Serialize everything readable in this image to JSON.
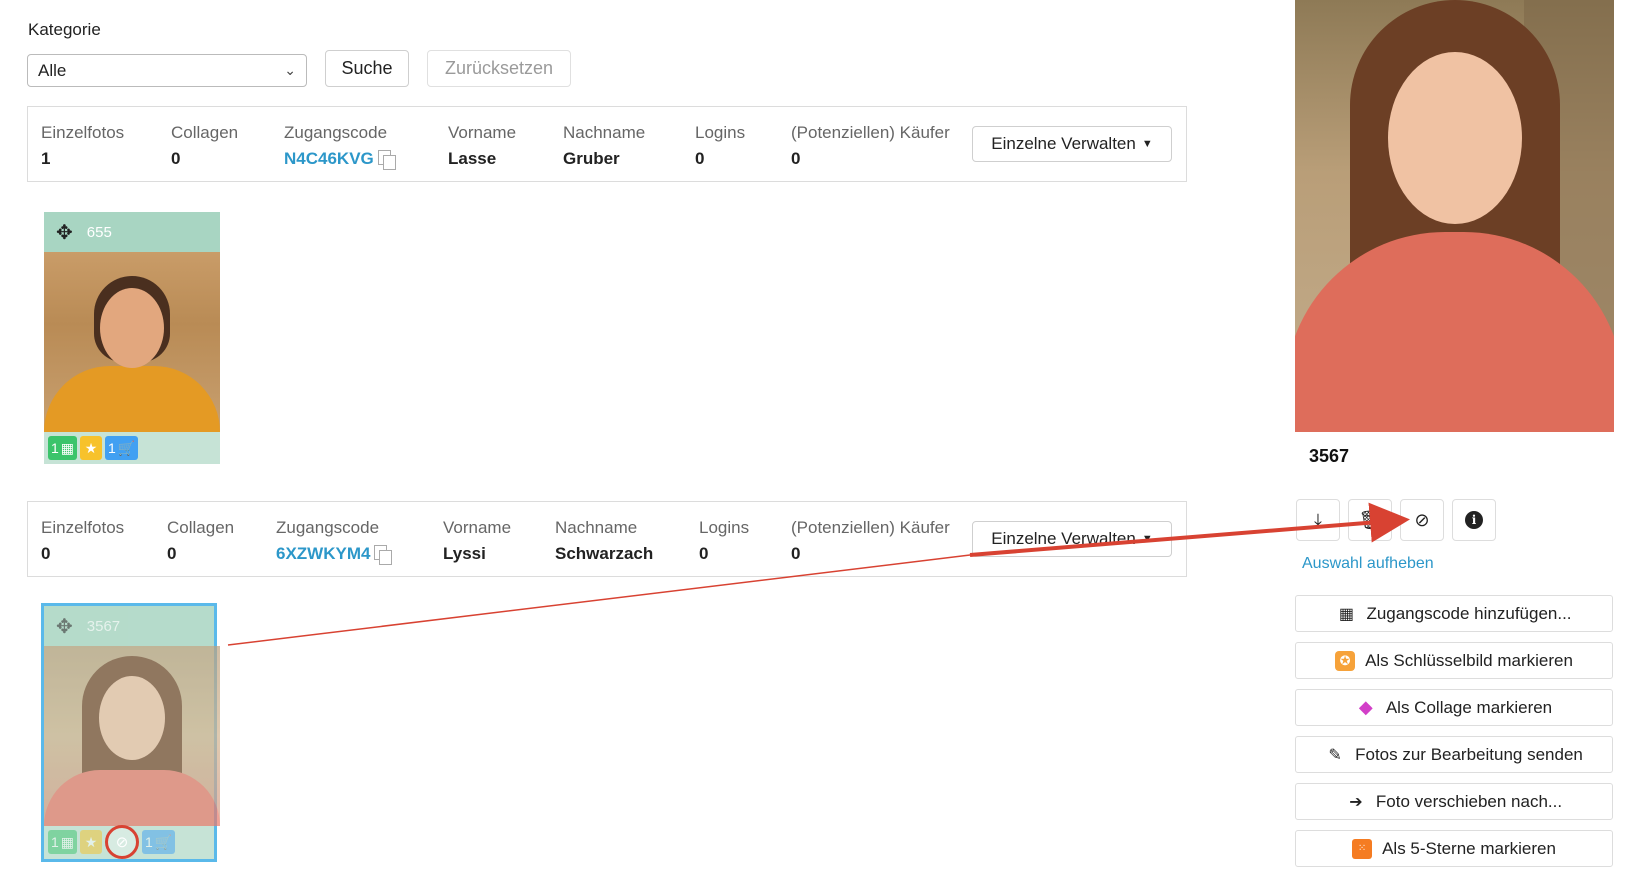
{
  "filter": {
    "label": "Kategorie",
    "category_value": "Alle",
    "search_label": "Suche",
    "reset_label": "Zurücksetzen"
  },
  "columns": [
    "Einzelfotos",
    "Collagen",
    "Zugangscode",
    "Vorname",
    "Nachname",
    "Logins",
    "(Potenziellen) Käufer"
  ],
  "groups": [
    {
      "einzelfotos": "1",
      "collagen": "0",
      "zugangscode": "N4C46KVG",
      "vorname": "Lasse",
      "nachname": "Gruber",
      "logins": "0",
      "kaeufer": "0",
      "manage_label": "Einzelne Verwalten",
      "photo": {
        "id": "655",
        "badge_codes": "1",
        "badge_cart": "1"
      }
    },
    {
      "einzelfotos": "0",
      "collagen": "0",
      "zugangscode": "6XZWKYM4",
      "vorname": "Lyssi",
      "nachname": "Schwarzach",
      "logins": "0",
      "kaeufer": "0",
      "manage_label": "Einzelne Verwalten",
      "photo": {
        "id": "3567",
        "badge_codes": "1",
        "badge_cart": "1",
        "hidden": true
      }
    }
  ],
  "detail": {
    "photo_id": "3567",
    "deselect_label": "Auswahl aufheben",
    "actions": [
      {
        "label": "Zugangscode hinzufügen...",
        "icon": "qr-code-icon"
      },
      {
        "label": "Als Schlüsselbild markieren",
        "icon": "key-image-icon"
      },
      {
        "label": "Als Collage markieren",
        "icon": "layers-icon"
      },
      {
        "label": "Fotos zur Bearbeitung senden",
        "icon": "edit-icon"
      },
      {
        "label": "Foto verschieben nach...",
        "icon": "file-move-icon"
      },
      {
        "label": "Als 5-Sterne markieren",
        "icon": "five-stars-icon"
      }
    ]
  },
  "colors": {
    "accent_link": "#2c97c9",
    "selection_border": "#5ab9ea",
    "annotation_red": "#d84232",
    "tile_header": "#a8d5c2"
  }
}
